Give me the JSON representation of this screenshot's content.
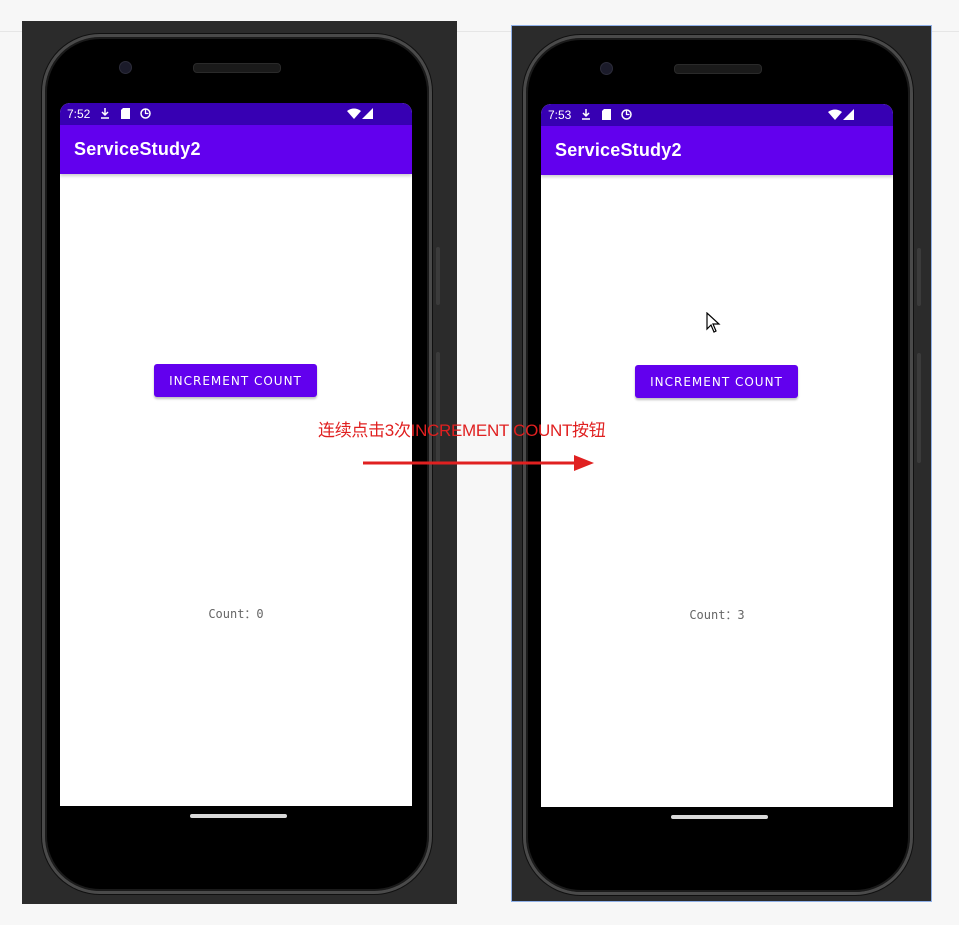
{
  "annotation": {
    "caption": "连续点击3次INCREMENT COUNT按钮",
    "arrow_color": "#e02020"
  },
  "before": {
    "status_time": "7:52",
    "app_title": "ServiceStudy2",
    "button_label": "INCREMENT COUNT",
    "count_text": "Count：0"
  },
  "after": {
    "status_time": "7:53",
    "app_title": "ServiceStudy2",
    "button_label": "INCREMENT COUNT",
    "count_text": "Count：3"
  },
  "colors": {
    "status_bar": "#3700b3",
    "app_bar": "#6200ee",
    "button": "#6200ee"
  },
  "icons": [
    "download-icon",
    "sim-card-icon",
    "sync-icon",
    "wifi-icon",
    "signal-icon",
    "home-pill"
  ]
}
